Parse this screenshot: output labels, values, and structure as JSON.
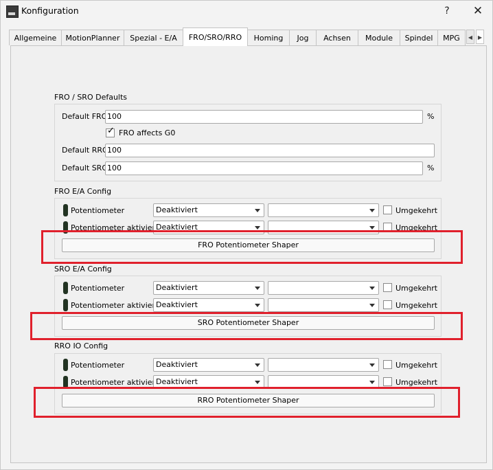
{
  "window": {
    "title": "Konfiguration",
    "help": "?",
    "close": "✕"
  },
  "tabs": [
    "Allgemeine",
    "MotionPlanner",
    "Spezial - E/A",
    "FRO/SRO/RRO",
    "Homing",
    "Jog",
    "Achsen",
    "Module",
    "Spindel",
    "MPG"
  ],
  "active_tab": "FRO/SRO/RRO",
  "defaults": {
    "title": "FRO / SRO Defaults",
    "fro_label": "Default FRO",
    "fro_value": "100",
    "fro_unit": "%",
    "g0_label": "FRO affects G0",
    "g0_checked": true,
    "rro_label": "Default RRO",
    "rro_value": "100",
    "sro_label": "Default SRO",
    "sro_value": "100",
    "sro_unit": "%"
  },
  "fro_config": {
    "title": "FRO E/A Config",
    "rows": [
      {
        "label": "Potentiometer",
        "mode": "Deaktiviert",
        "pin": "",
        "invert": "Umgekehrt"
      },
      {
        "label": "Potentiometer aktivieren",
        "mode": "Deaktiviert",
        "pin": "",
        "invert": "Umgekehrt"
      }
    ],
    "shaper": "FRO Potentiometer Shaper"
  },
  "sro_config": {
    "title": "SRO E/A Config",
    "rows": [
      {
        "label": "Potentiometer",
        "mode": "Deaktiviert",
        "pin": "",
        "invert": "Umgekehrt"
      },
      {
        "label": "Potentiometer aktivieren",
        "mode": "Deaktiviert",
        "pin": "",
        "invert": "Umgekehrt"
      }
    ],
    "shaper": "SRO Potentiometer Shaper"
  },
  "rro_config": {
    "title": "RRO IO Config",
    "rows": [
      {
        "label": "Potentiometer",
        "mode": "Deaktiviert",
        "pin": "",
        "invert": "Umgekehrt"
      },
      {
        "label": "Potentiometer aktivieren",
        "mode": "Deaktiviert",
        "pin": "",
        "invert": "Umgekehrt"
      }
    ],
    "shaper": "RRO Potentiometer Shaper"
  },
  "colors": {
    "highlight": "#e0202c",
    "led": "#223322"
  }
}
